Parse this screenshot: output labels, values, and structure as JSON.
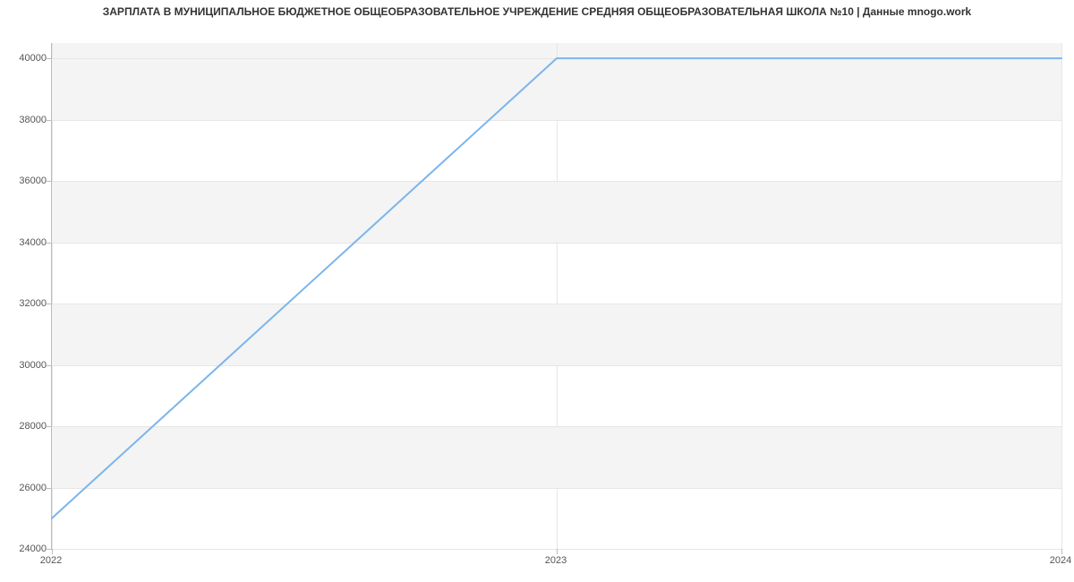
{
  "chart_data": {
    "type": "line",
    "title": "ЗАРПЛАТА В МУНИЦИПАЛЬНОЕ БЮДЖЕТНОЕ ОБЩЕОБРАЗОВАТЕЛЬНОЕ УЧРЕЖДЕНИЕ СРЕДНЯЯ ОБЩЕОБРАЗОВАТЕЛЬНАЯ ШКОЛА №10 | Данные mnogo.work",
    "x": [
      "2022",
      "2023",
      "2024"
    ],
    "values": [
      25000,
      40000,
      40000
    ],
    "y_ticks": [
      24000,
      26000,
      28000,
      30000,
      32000,
      34000,
      36000,
      38000,
      40000
    ],
    "ylim": [
      24000,
      40500
    ],
    "xlabel": "",
    "ylabel": "",
    "colors": {
      "line": "#7cb5ec",
      "band": "#f4f4f4"
    }
  }
}
